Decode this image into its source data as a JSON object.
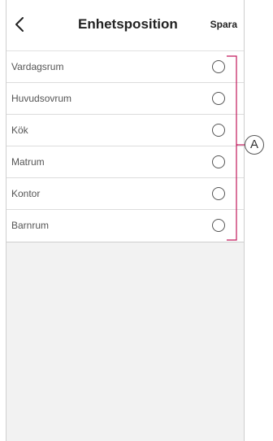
{
  "header": {
    "title": "Enhetsposition",
    "save_label": "Spara",
    "back_icon": "chevron-left-icon"
  },
  "rooms": [
    {
      "label": "Vardagsrum",
      "selected": false
    },
    {
      "label": "Huvudsovrum",
      "selected": false
    },
    {
      "label": "Kök",
      "selected": false
    },
    {
      "label": "Matrum",
      "selected": false
    },
    {
      "label": "Kontor",
      "selected": false
    },
    {
      "label": "Barnrum",
      "selected": false
    }
  ],
  "annotation": {
    "label": "A"
  },
  "colors": {
    "accent_bracket": "#c2185b",
    "radio_border": "#555555",
    "page_background": "#f2f2f2"
  }
}
